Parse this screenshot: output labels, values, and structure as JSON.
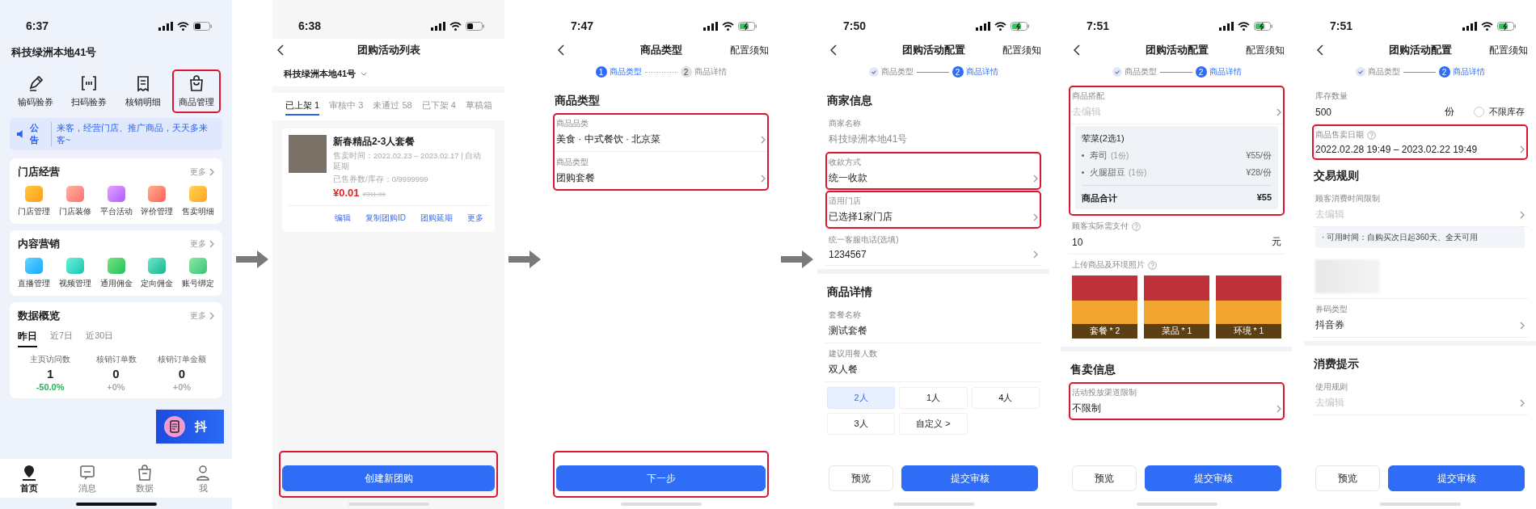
{
  "phones": [
    {
      "kind": "home",
      "time": "6:37",
      "charging": false,
      "arrow_after": true,
      "blocks": [
        {
          "kind": "store_title",
          "text": "科技绿洲本地41号"
        },
        {
          "kind": "shortcuts",
          "items": [
            {
              "label": "输码验券",
              "highlighted": false
            },
            {
              "label": "扫码验券",
              "highlighted": false
            },
            {
              "label": "核销明细",
              "highlighted": false
            },
            {
              "label": "商品管理",
              "highlighted": true
            }
          ]
        },
        {
          "kind": "notice",
          "label": "公告",
          "text": "来客，经营门店、推广商品，天天多来客~"
        },
        {
          "kind": "icon_card",
          "title": "门店经营",
          "more": "更多",
          "items": [
            "门店管理",
            "门店装修",
            "平台活动",
            "评价管理",
            "售卖明细"
          ]
        },
        {
          "kind": "icon_card",
          "title": "内容营销",
          "more": "更多",
          "items": [
            "直播管理",
            "视频管理",
            "通用佣金",
            "定向佣金",
            "账号绑定"
          ]
        },
        {
          "kind": "stats_card",
          "title": "数据概览",
          "more": "更多",
          "tabs": [
            {
              "label": "昨日",
              "selected": true
            },
            {
              "label": "近7日",
              "selected": false
            },
            {
              "label": "近30日",
              "selected": false
            }
          ],
          "stats": [
            {
              "label": "主页访问数",
              "value": "1",
              "change": "-50.0%",
              "color": "#27b35a"
            },
            {
              "label": "核销订单数",
              "value": "0",
              "change": "+0%",
              "color": "#aaaaaa"
            },
            {
              "label": "核销订单金额",
              "value": "0",
              "change": "+0%",
              "color": "#aaaaaa"
            }
          ]
        },
        {
          "kind": "banner",
          "text": "抖"
        }
      ],
      "tabbar": [
        {
          "label": "首页",
          "selected": true
        },
        {
          "label": "消息",
          "selected": false
        },
        {
          "label": "数据",
          "selected": false
        },
        {
          "label": "我",
          "selected": false
        }
      ]
    },
    {
      "kind": "list",
      "time": "6:38",
      "charging": false,
      "arrow_after": true,
      "header": {
        "title": "团购活动列表"
      },
      "blocks": [
        {
          "kind": "store_select",
          "text": "科技绿洲本地41号"
        },
        {
          "kind": "tabs",
          "items": [
            {
              "label": "已上架 1",
              "selected": true
            },
            {
              "label": "审核中 3",
              "selected": false
            },
            {
              "label": "未通过 58",
              "selected": false
            },
            {
              "label": "已下架 4",
              "selected": false
            },
            {
              "label": "草稿箱",
              "selected": false
            }
          ]
        },
        {
          "kind": "product_card",
          "title": "新春精品2-3人套餐",
          "lines": [
            "售卖时间：2022.02.23 – 2023.02.17 | 自动延期",
            "已售券数/库存：0/9999999"
          ],
          "price": "¥0.01",
          "original_price": "¥311.00",
          "actions": [
            "编辑",
            "复制团购ID",
            "团购延期",
            "更多"
          ]
        }
      ],
      "footer": {
        "highlighted": true,
        "buttons": [
          {
            "label": "创建新团购",
            "kind": "primary"
          }
        ]
      }
    },
    {
      "kind": "form",
      "time": "7:47",
      "charging": true,
      "arrow_after": true,
      "header": {
        "title": "商品类型",
        "right": "配置须知"
      },
      "blocks": [
        {
          "kind": "stepper",
          "steps": [
            {
              "label": "商品类型",
              "done": false,
              "selected": true,
              "number": "1"
            },
            {
              "label": "商品详情",
              "done": false,
              "selected": false,
              "number": "2"
            }
          ]
        },
        {
          "kind": "section_title",
          "text": "商品类型"
        },
        {
          "kind": "group",
          "highlighted": true,
          "blocks": [
            {
              "kind": "field",
              "label": "商品品类",
              "value": "美食 · 中式餐饮 · 北京菜",
              "chevron": true
            },
            {
              "kind": "field",
              "label": "商品类型",
              "value": "团购套餐",
              "chevron": true
            }
          ]
        }
      ],
      "footer": {
        "highlighted": true,
        "buttons": [
          {
            "label": "下一步",
            "kind": "primary"
          }
        ]
      }
    },
    {
      "kind": "form",
      "time": "7:50",
      "charging": true,
      "arrow_after": false,
      "header": {
        "title": "团购活动配置",
        "right": "配置须知"
      },
      "blocks": [
        {
          "kind": "stepper",
          "steps": [
            {
              "label": "商品类型",
              "done": true,
              "selected": false
            },
            {
              "label": "商品详情",
              "done": false,
              "selected": true,
              "number": "2"
            }
          ]
        },
        {
          "kind": "section_title",
          "text": "商家信息"
        },
        {
          "kind": "field",
          "label": "商家名称",
          "value": "科技绿洲本地41号",
          "readonly": true,
          "chevron": false
        },
        {
          "kind": "field",
          "label": "收款方式",
          "value": "统一收款",
          "chevron": true,
          "highlighted": true
        },
        {
          "kind": "field",
          "label": "适用门店",
          "value": "已选择1家门店",
          "chevron": true,
          "highlighted": true
        },
        {
          "kind": "field",
          "label": "统一客服电话(选填)",
          "value": "1234567",
          "chevron": true
        },
        {
          "kind": "divider"
        },
        {
          "kind": "section_title",
          "text": "商品详情"
        },
        {
          "kind": "field",
          "label": "套餐名称",
          "value": "测试套餐",
          "chevron": false
        },
        {
          "kind": "field",
          "label": "建议用餐人数",
          "value": "双人餐",
          "chevron": false
        },
        {
          "kind": "chips",
          "items": [
            {
              "label": "2人",
              "selected": true
            },
            {
              "label": "1人",
              "selected": false
            },
            {
              "label": "4人",
              "selected": false
            },
            {
              "label": "3人",
              "selected": false
            },
            {
              "label": "自定义 >",
              "selected": false
            }
          ]
        }
      ],
      "footer": {
        "highlighted": false,
        "buttons": [
          {
            "label": "预览",
            "kind": "secondary"
          },
          {
            "label": "提交审核",
            "kind": "primary"
          }
        ]
      }
    },
    {
      "kind": "form",
      "time": "7:51",
      "charging": true,
      "arrow_after": false,
      "header": {
        "title": "团购活动配置",
        "right": "配置须知"
      },
      "blocks": [
        {
          "kind": "stepper",
          "steps": [
            {
              "label": "商品类型",
              "done": true,
              "selected": false
            },
            {
              "label": "商品详情",
              "done": false,
              "selected": true,
              "number": "2"
            }
          ]
        },
        {
          "kind": "group",
          "highlighted": true,
          "blocks": [
            {
              "kind": "field",
              "label": "商品搭配",
              "placeholder": "去编辑",
              "chevron": true
            },
            {
              "kind": "combo_panel",
              "title": "荤菜(2选1)",
              "items": [
                {
                  "name": "寿司",
                  "qty": "(1份)",
                  "price": "¥55/份"
                },
                {
                  "name": "火腿甜豆",
                  "qty": "(1份)",
                  "price": "¥28/份"
                }
              ],
              "total_label": "商品合计",
              "total": "¥55"
            }
          ]
        },
        {
          "kind": "field",
          "label": "顾客实际需支付",
          "help": true,
          "value": "10",
          "unit": "元",
          "chevron": false
        },
        {
          "kind": "photos",
          "label": "上传商品及环境照片",
          "help": true,
          "items": [
            "套餐 * 2",
            "菜品 * 1",
            "环境 * 1"
          ]
        },
        {
          "kind": "divider"
        },
        {
          "kind": "section_title",
          "text": "售卖信息"
        },
        {
          "kind": "field",
          "label": "活动投放渠道限制",
          "value": "不限制",
          "chevron": true,
          "highlighted": true
        }
      ],
      "footer": {
        "highlighted": false,
        "buttons": [
          {
            "label": "预览",
            "kind": "secondary"
          },
          {
            "label": "提交审核",
            "kind": "primary"
          }
        ]
      }
    },
    {
      "kind": "form",
      "time": "7:51",
      "charging": true,
      "arrow_after": false,
      "header": {
        "title": "团购活动配置",
        "right": "配置须知"
      },
      "blocks": [
        {
          "kind": "stepper",
          "steps": [
            {
              "label": "商品类型",
              "done": true,
              "selected": false
            },
            {
              "label": "商品详情",
              "done": false,
              "selected": true,
              "number": "2"
            }
          ]
        },
        {
          "kind": "stock_field",
          "label": "库存数量",
          "value": "500",
          "unit": "份",
          "option": "不限库存",
          "checked": false
        },
        {
          "kind": "field",
          "label": "商品售卖日期",
          "help": true,
          "value": "2022.02.28 19:49 – 2023.02.22 19:49",
          "chevron": true,
          "highlighted": true
        },
        {
          "kind": "section_title",
          "text": "交易规则"
        },
        {
          "kind": "field",
          "label": "顾客消费时间限制",
          "placeholder": "去编辑",
          "chevron": true
        },
        {
          "kind": "note",
          "text": "· 可用时间：自购买次日起360天、全天可用"
        },
        {
          "kind": "redacted"
        },
        {
          "kind": "field",
          "label": "券码类型",
          "value": "抖音券",
          "chevron": true
        },
        {
          "kind": "divider"
        },
        {
          "kind": "section_title",
          "text": "消费提示"
        },
        {
          "kind": "field",
          "label": "使用规则",
          "placeholder": "去编辑",
          "chevron": true
        }
      ],
      "footer": {
        "highlighted": false,
        "buttons": [
          {
            "label": "预览",
            "kind": "secondary"
          },
          {
            "label": "提交审核",
            "kind": "primary"
          }
        ]
      }
    }
  ]
}
